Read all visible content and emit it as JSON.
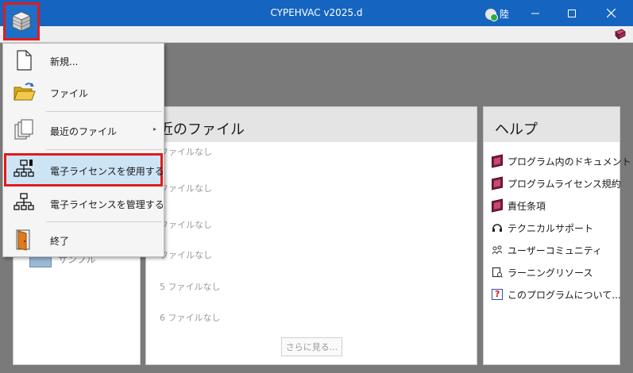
{
  "window": {
    "title": "CYPEHVAC v2025.d",
    "user": "陸"
  },
  "menu": {
    "items": [
      {
        "label": "新規...",
        "icon": "new-file-icon"
      },
      {
        "label": "ファイル",
        "icon": "folder-open-icon"
      },
      {
        "label": "最近のファイル",
        "icon": "recent-files-icon"
      },
      {
        "label": "電子ライセンスを使用する",
        "icon": "network-license-icon"
      },
      {
        "label": "電子ライセンスを管理する",
        "icon": "network-manage-icon"
      },
      {
        "label": "終了",
        "icon": "exit-door-icon"
      }
    ]
  },
  "left_panel": {
    "sample_label": "サンプル"
  },
  "recent": {
    "title": "最近のファイル",
    "title_visible": "近のファイル",
    "items": [
      "1 ファイルなし",
      "2 ファイルなし",
      "3 ファイルなし",
      "4 ファイルなし",
      "5 ファイルなし",
      "6 ファイルなし"
    ],
    "items_visible": [
      "ファイルなし",
      "ファイルなし",
      "ファイルなし",
      "ファイルなし",
      "5 ファイルなし",
      "6 ファイルなし"
    ],
    "more_button": "さらに見る..."
  },
  "help": {
    "title": "ヘルプ",
    "items": [
      {
        "label": "プログラム内のドキュメント",
        "icon": "book-icon"
      },
      {
        "label": "プログラムライセンス規約",
        "icon": "book-icon"
      },
      {
        "label": "責任条項",
        "icon": "book-icon"
      },
      {
        "label": "テクニカルサポート",
        "icon": "headset-icon"
      },
      {
        "label": "ユーザーコミュニティ",
        "icon": "community-icon"
      },
      {
        "label": "ラーニングリソース",
        "icon": "learning-icon"
      },
      {
        "label": "このプログラムについて...",
        "icon": "about-icon"
      }
    ]
  }
}
